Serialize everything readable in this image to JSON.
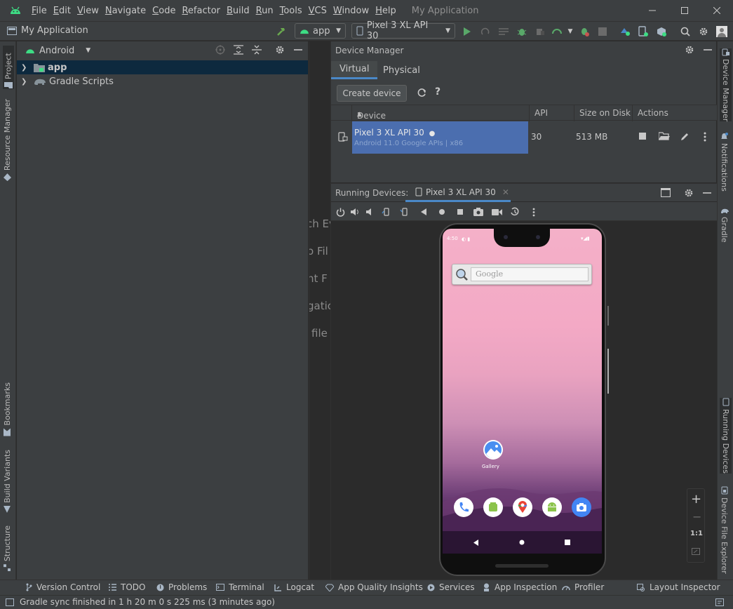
{
  "colors": {
    "android_green": "#3ddc84",
    "selection_blue": "#4b6eaf",
    "accent": "#4a88c7"
  },
  "menu": [
    "File",
    "Edit",
    "View",
    "Navigate",
    "Code",
    "Refactor",
    "Build",
    "Run",
    "Tools",
    "VCS",
    "Window",
    "Help"
  ],
  "window_title": "My Application",
  "navbar": {
    "project_name": "My Application",
    "run_config": "app",
    "device": "Pixel 3 XL API 30"
  },
  "left_tabs": {
    "project": "Project",
    "resource_manager": "Resource Manager",
    "bookmarks": "Bookmarks",
    "build_variants": "Build Variants",
    "structure": "Structure"
  },
  "right_tabs": {
    "device_manager": "Device Manager",
    "notifications": "Notifications",
    "gradle": "Gradle",
    "running_devices": "Running Devices",
    "device_file_explorer": "Device File Explorer"
  },
  "project_panel": {
    "view_mode": "Android",
    "tree": [
      {
        "label": "app"
      },
      {
        "label": "Gradle Scripts"
      }
    ]
  },
  "editor_hints": [
    "ch Ev",
    "o Fil",
    "nt F",
    "gatic",
    "file"
  ],
  "device_manager": {
    "title": "Device Manager",
    "tabs": [
      "Virtual",
      "Physical"
    ],
    "create_button": "Create device",
    "help_symbol": "?",
    "columns": {
      "device": "Device",
      "api": "API",
      "size": "Size on Disk",
      "actions": "Actions"
    },
    "row": {
      "name": "Pixel 3 XL API 30",
      "subtitle": "Android 11.0 Google APIs | x86",
      "api": "30",
      "size": "513 MB"
    }
  },
  "running_devices": {
    "title": "Running Devices:",
    "tab": "Pixel 3 XL API 30"
  },
  "phone": {
    "time": "4:50",
    "search_hint": "Google",
    "gallery_label": "Gallery",
    "zoom_ratio": "1:1"
  },
  "bottom_tabs": [
    "Version Control",
    "TODO",
    "Problems",
    "Terminal",
    "Logcat",
    "App Quality Insights",
    "Services",
    "App Inspection",
    "Profiler",
    "Layout Inspector"
  ],
  "status": "Gradle sync finished in 1 h 20 m 0 s 225 ms (3 minutes ago)"
}
